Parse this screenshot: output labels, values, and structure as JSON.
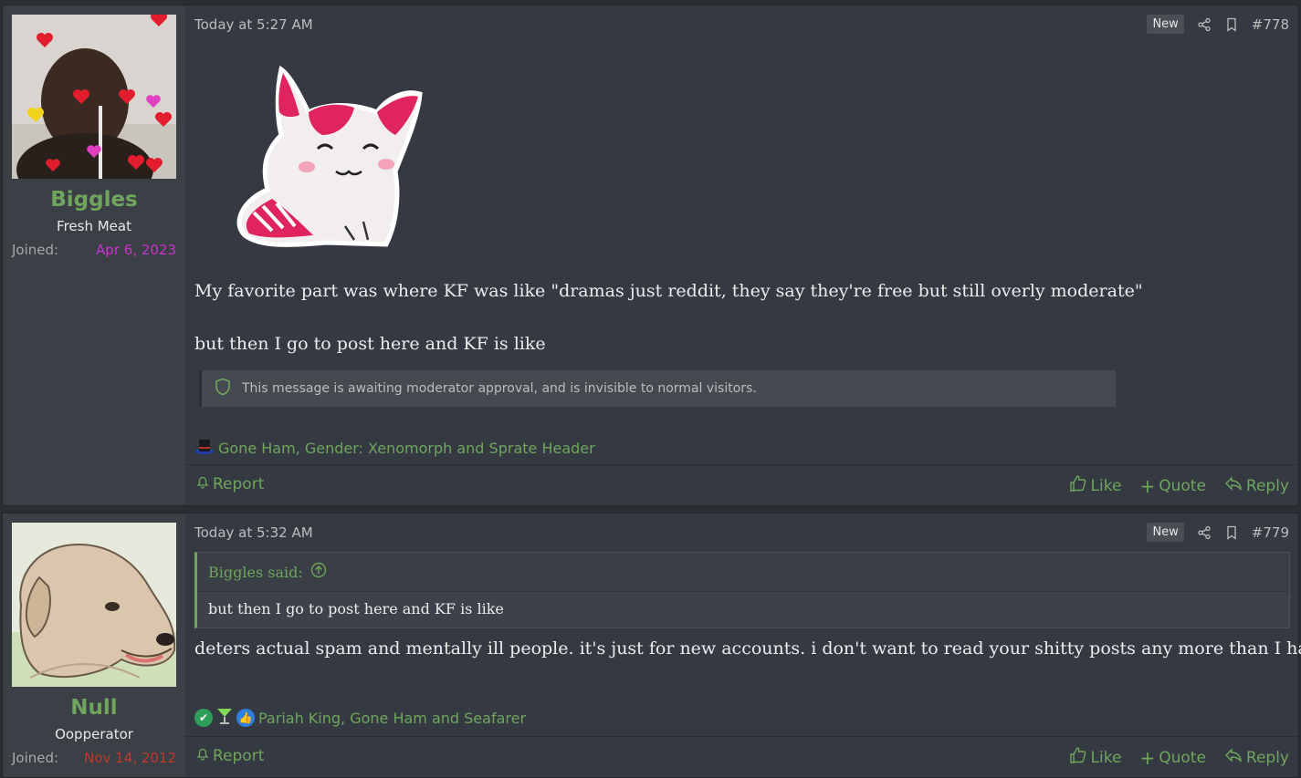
{
  "posts": [
    {
      "user": {
        "name": "Biggles",
        "title": "Fresh Meat",
        "joined_label": "Joined:",
        "joined_date": "Apr 6, 2023",
        "joined_color": "#cc33cc"
      },
      "timestamp": "Today at 5:27 AM",
      "new_label": "New",
      "number": "#778",
      "lines": [
        "My favorite part was where KF was like \"dramas just reddit, they say they're free but still overly moderate\"",
        "but then I go to post here and KF is like"
      ],
      "mod_notice": "This message is awaiting moderator approval, and is invisible to normal visitors.",
      "reactions_text": "Gone Ham, Gender: Xenomorph and Sprate Header",
      "report_label": "Report",
      "actions": {
        "like": "Like",
        "quote": "Quote",
        "reply": "Reply"
      }
    },
    {
      "user": {
        "name": "Null",
        "title": "Oopperator",
        "joined_label": "Joined:",
        "joined_date": "Nov 14, 2012",
        "joined_color": "#c0392b"
      },
      "timestamp": "Today at 5:32 AM",
      "new_label": "New",
      "number": "#779",
      "quote_head": "Biggles said:",
      "quote_body": "but then I go to post here and KF is like",
      "lines": [
        "deters actual spam and mentally ill people. it's just for new accounts. i don't want to read your shitty posts any more than I have to."
      ],
      "reactions_text": "Pariah King, Gone Ham and Seafarer",
      "report_label": "Report",
      "actions": {
        "like": "Like",
        "quote": "Quote",
        "reply": "Reply"
      }
    }
  ],
  "colors": {
    "accent": "#6fa55c",
    "background": "#353a42",
    "panel": "#3b3f46"
  }
}
